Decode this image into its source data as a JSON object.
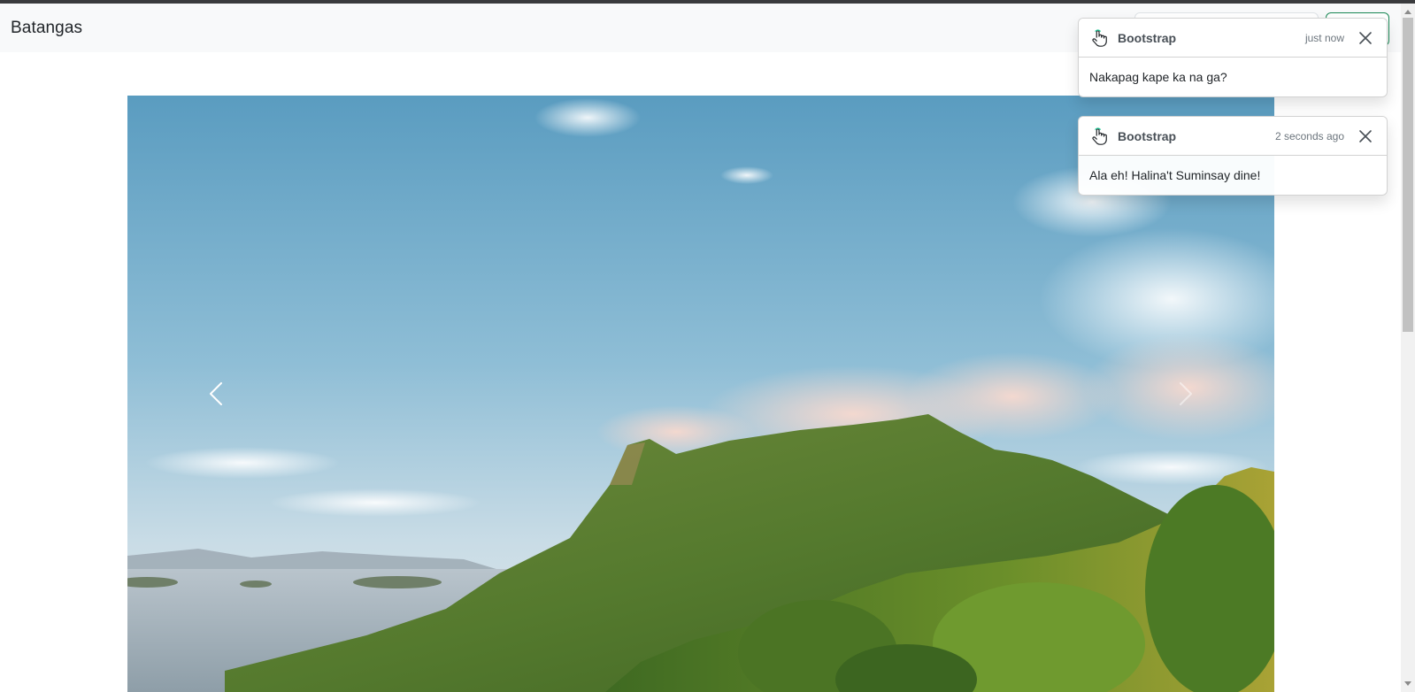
{
  "navbar": {
    "brand": "Batangas",
    "search_placeholder": "",
    "search_button": ""
  },
  "carousel": {
    "image": "mountain-lake-landscape",
    "prev_label": "Previous",
    "next_label": "Next"
  },
  "toasts": [
    {
      "icon": "hand-pointer-icon",
      "title": "Bootstrap",
      "time": "just now",
      "message": "Nakapag kape ka na ga?"
    },
    {
      "icon": "hand-pointer-icon",
      "title": "Bootstrap",
      "time": "2 seconds ago",
      "message": "Ala eh! Halina't Suminsay dine!"
    }
  ],
  "colors": {
    "navbar_bg": "#f8f9fa",
    "success": "#198754",
    "sky": "#5fa2c2",
    "foliage": "#4f7a2a"
  }
}
